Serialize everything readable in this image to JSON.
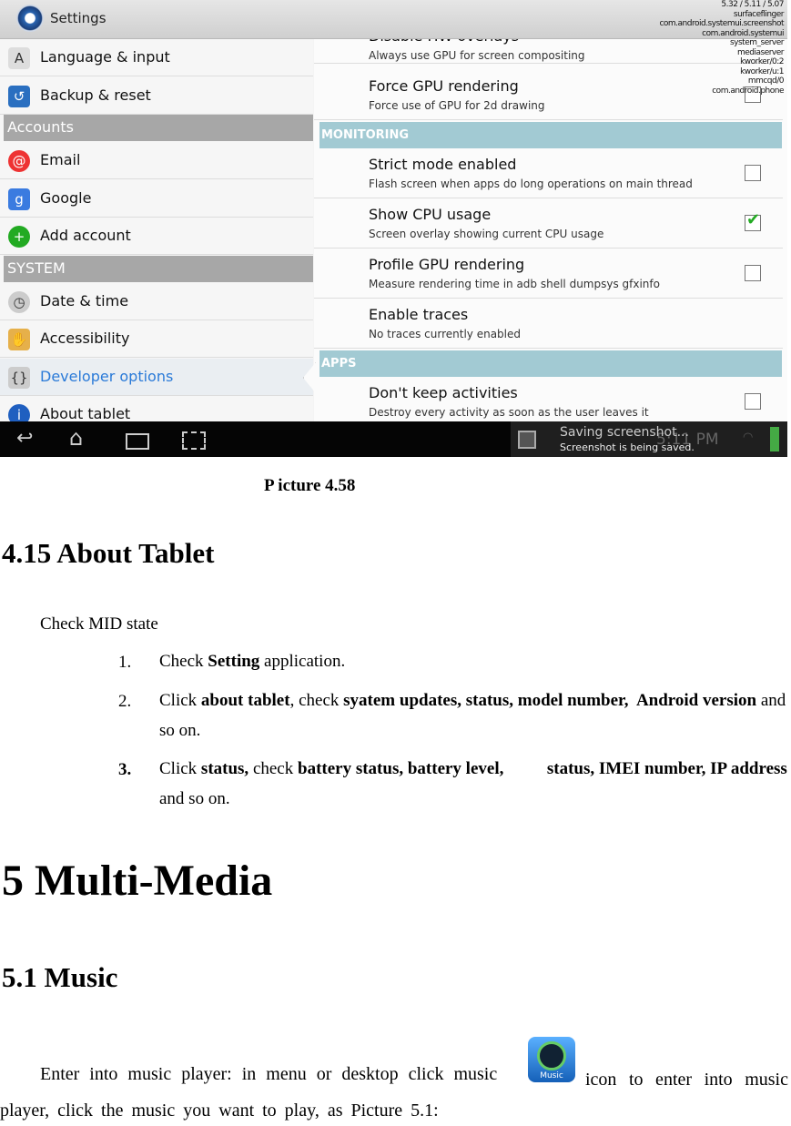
{
  "screenshot": {
    "title": "Settings",
    "overlay": [
      "5.32 / 5.11 / 5.07",
      "surfaceflinger",
      "com.android.systemui.screenshot",
      "com.android.systemui",
      "system_server",
      "mediaserver",
      "kworker/0:2",
      "kworker/u:1",
      "mmcqd/0",
      "com.android.phone"
    ],
    "left": {
      "items": [
        {
          "label": "Language & input",
          "icon": "language-icon"
        },
        {
          "label": "Backup & reset",
          "icon": "backup-icon"
        },
        {
          "header": "Accounts"
        },
        {
          "label": "Email",
          "icon": "email-icon"
        },
        {
          "label": "Google",
          "icon": "google-icon"
        },
        {
          "label": "Add account",
          "icon": "add-icon"
        },
        {
          "header": "SYSTEM"
        },
        {
          "label": "Date & time",
          "icon": "clock-icon"
        },
        {
          "label": "Accessibility",
          "icon": "hand-icon"
        },
        {
          "label": "Developer options",
          "icon": "braces-icon",
          "selected": true
        },
        {
          "label": "About tablet",
          "icon": "info-icon"
        }
      ]
    },
    "right": {
      "items": [
        {
          "title": "Disable HW overlays",
          "summary": "Always use GPU for screen compositing"
        },
        {
          "title": "Force GPU rendering",
          "summary": "Force use of GPU for 2d drawing",
          "checked": false
        },
        {
          "header": "MONITORING"
        },
        {
          "title": "Strict mode enabled",
          "summary": "Flash screen when apps do long operations on main thread",
          "checked": false
        },
        {
          "title": "Show CPU usage",
          "summary": "Screen overlay showing current CPU usage",
          "checked": true
        },
        {
          "title": "Profile GPU rendering",
          "summary": "Measure rendering time in adb shell dumpsys gfxinfo",
          "checked": false
        },
        {
          "title": "Enable traces",
          "summary": "No traces currently enabled"
        },
        {
          "header": "APPS"
        },
        {
          "title": "Don't keep activities",
          "summary": "Destroy every activity as soon as the user leaves it",
          "checked": false
        }
      ]
    },
    "notification": {
      "title": "Saving screenshot...",
      "text": "Screenshot is being saved.",
      "clock": "5:11 PM"
    }
  },
  "caption": "P icture 4.58",
  "section_415": {
    "heading": "4.15 About Tablet",
    "intro": "Check MID state",
    "steps": [
      {
        "num": "1.",
        "parts": [
          [
            "Check ",
            0
          ],
          [
            "Setting",
            1
          ],
          [
            " application.",
            0
          ]
        ]
      },
      {
        "num": "2.",
        "parts": [
          [
            "Click ",
            0
          ],
          [
            "about tablet",
            1
          ],
          [
            ", check ",
            0
          ],
          [
            "syatem updates, status, model number,  Android version",
            1
          ],
          [
            " and so on.",
            0
          ]
        ]
      },
      {
        "num": "3.",
        "parts": [
          [
            "Click ",
            0
          ],
          [
            "status,",
            1
          ],
          [
            " check ",
            0
          ],
          [
            "battery status, battery level,          status, IMEI number, IP address",
            1
          ],
          [
            " and so on.",
            0
          ]
        ]
      }
    ]
  },
  "chapter5": {
    "heading": "5 Multi-Media"
  },
  "section_51": {
    "heading": "5.1 Music",
    "para_before": "Enter into music player: in menu or desktop click music",
    "icon_label": "Music",
    "para_after": "icon to enter into music player, click the music you want to play, as Picture 5.1:"
  }
}
